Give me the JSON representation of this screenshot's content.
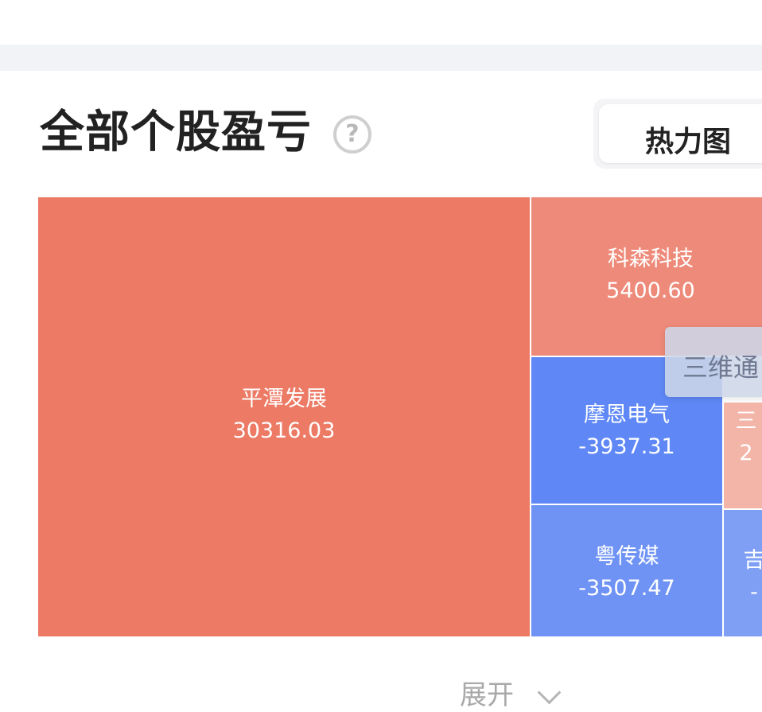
{
  "header": {
    "title": "全部个股盈亏",
    "help_icon": "question-circle-icon"
  },
  "view_toggle": {
    "active_label": "热力图"
  },
  "tooltip": {
    "text": "三维通"
  },
  "footer": {
    "expand_label": "展开",
    "expand_icon": "chevron-down-icon"
  },
  "colors": {
    "profit_strong": "#ec7a65",
    "profit_medium": "#ee8a79",
    "profit_light": "#f3b5a8",
    "loss_strong": "#5f88f6",
    "loss_medium": "#6f93f4",
    "loss_light": "#7f9ff5"
  },
  "chart_data": {
    "type": "treemap",
    "items": [
      {
        "name": "平潭发展",
        "value": "30316.03",
        "color": "#ec7a65"
      },
      {
        "name": "科森科技",
        "value": "5400.60",
        "color": "#ee8a79"
      },
      {
        "name": "摩恩电气",
        "value": "-3937.31",
        "color": "#5f88f6"
      },
      {
        "name": "三",
        "value": "2",
        "color": "#f3b5a8"
      },
      {
        "name": "粤传媒",
        "value": "-3507.47",
        "color": "#6f93f4"
      },
      {
        "name": "吉",
        "value": "-",
        "color": "#7f9ff5"
      }
    ]
  }
}
